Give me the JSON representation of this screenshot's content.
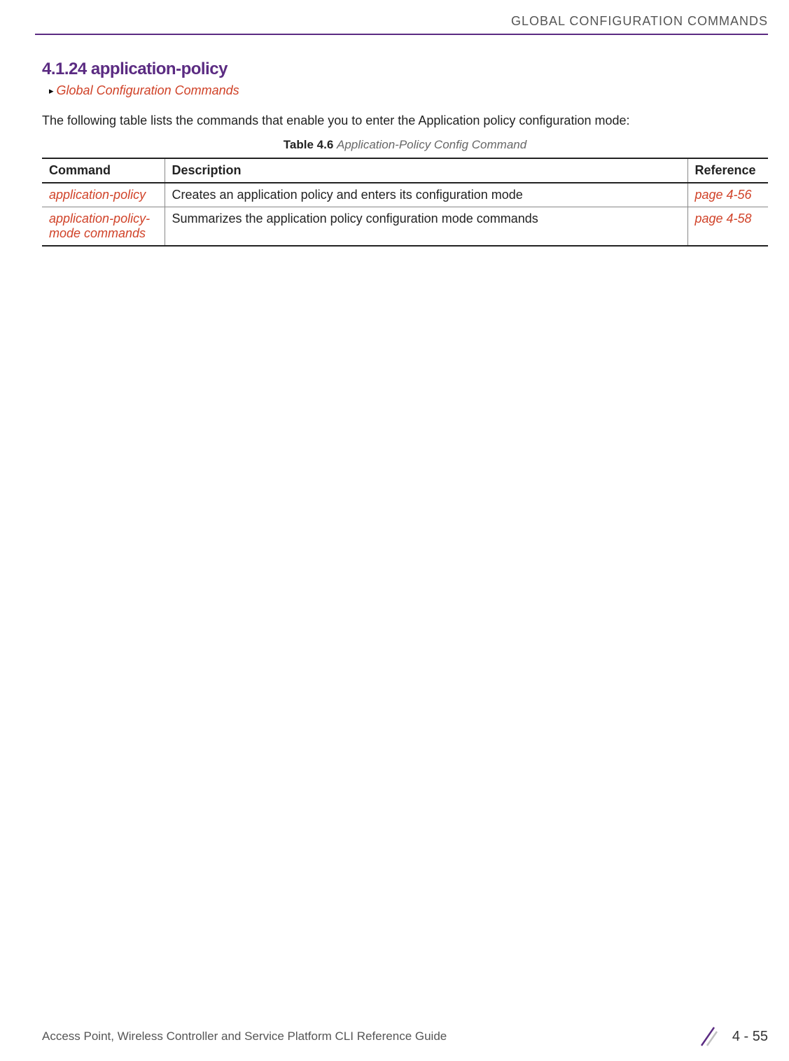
{
  "header": {
    "running_title": "GLOBAL CONFIGURATION COMMANDS"
  },
  "section": {
    "number_and_title": "4.1.24 application-policy",
    "breadcrumb": "Global Configuration Commands",
    "intro": "The following table lists the commands that enable you to enter the Application policy configuration mode:"
  },
  "table": {
    "caption_label": "Table 4.6",
    "caption_title": " Application-Policy Config Command",
    "headers": {
      "command": "Command",
      "description": "Description",
      "reference": "Reference"
    },
    "rows": [
      {
        "command": "application-policy",
        "description": "Creates an application policy and enters its configuration mode",
        "reference": "page 4-56"
      },
      {
        "command": "application-policy- mode commands",
        "description": "Summarizes the application policy configuration mode commands",
        "reference": "page 4-58"
      }
    ]
  },
  "footer": {
    "guide_title": "Access Point, Wireless Controller and Service Platform CLI Reference Guide",
    "page_number": "4 - 55"
  },
  "colors": {
    "brand_purple": "#5b2b82",
    "link_red": "#d04228"
  }
}
